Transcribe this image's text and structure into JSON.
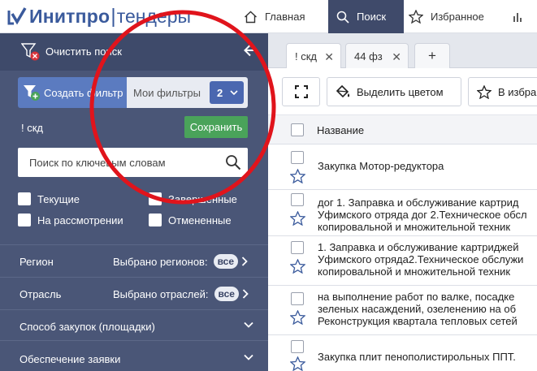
{
  "header": {
    "logo_bold": "Инитпро",
    "logo_sep": "|",
    "logo_light": "тендеры",
    "nav": [
      {
        "label": "Главная"
      },
      {
        "label": "Поиск"
      },
      {
        "label": "Избранное"
      }
    ]
  },
  "sidebar": {
    "clear_label": "Очистить поиск",
    "create_filter": "Создать фильтр",
    "my_filters": "Мои фильтры",
    "filters_count": "2",
    "filter_name": "! скд",
    "save_label": "Сохранить",
    "search_placeholder": "Поиск по ключевым словам",
    "checkboxes": [
      {
        "label": "Текущие"
      },
      {
        "label": "Завершенные"
      },
      {
        "label": "На рассмотрении"
      },
      {
        "label": "Отмененные"
      }
    ],
    "sections": [
      {
        "label": "Регион",
        "value": "Выбрано регионов:",
        "pill": "все"
      },
      {
        "label": "Отрасль",
        "value": "Выбрано отраслей:",
        "pill": "все"
      },
      {
        "label": "Способ закупок (площадки)"
      },
      {
        "label": "Обеспечение заявки"
      }
    ]
  },
  "main": {
    "tabs": [
      {
        "label": "! скд",
        "close": "✕"
      },
      {
        "label": "44 фз",
        "close": "✕"
      },
      {
        "label": "+"
      }
    ],
    "toolbar": {
      "highlight_label": "Выделить цветом",
      "favorites_label": "В избра"
    },
    "table": {
      "header": "Название",
      "rows": [
        {
          "lines": [
            "Закупка Мотор-редуктора"
          ]
        },
        {
          "lines": [
            "дог 1. Заправка и обслуживание картрид",
            "Уфимского отряда дог 2.Техническое обсл",
            "копировальной и множительной техник"
          ]
        },
        {
          "lines": [
            "1. Заправка и обслуживание картриджей",
            "Уфимского отряда2.Техническое обслужи",
            "копировальной и множительной техник"
          ]
        },
        {
          "lines": [
            "на выполнение работ по валке, посадке",
            "зеленых насаждений, озеленению на об",
            "Реконструкция квартала тепловых сетей"
          ]
        },
        {
          "lines": [
            "Закупка плит пенополистирольных ППТ."
          ]
        }
      ]
    }
  },
  "colors": {
    "sidebar_bg": "#4a5677",
    "nav_active": "#3f4a6a",
    "brand": "#3a5a9c",
    "save_green": "#4aa35a",
    "annotation": "#e0141c"
  }
}
